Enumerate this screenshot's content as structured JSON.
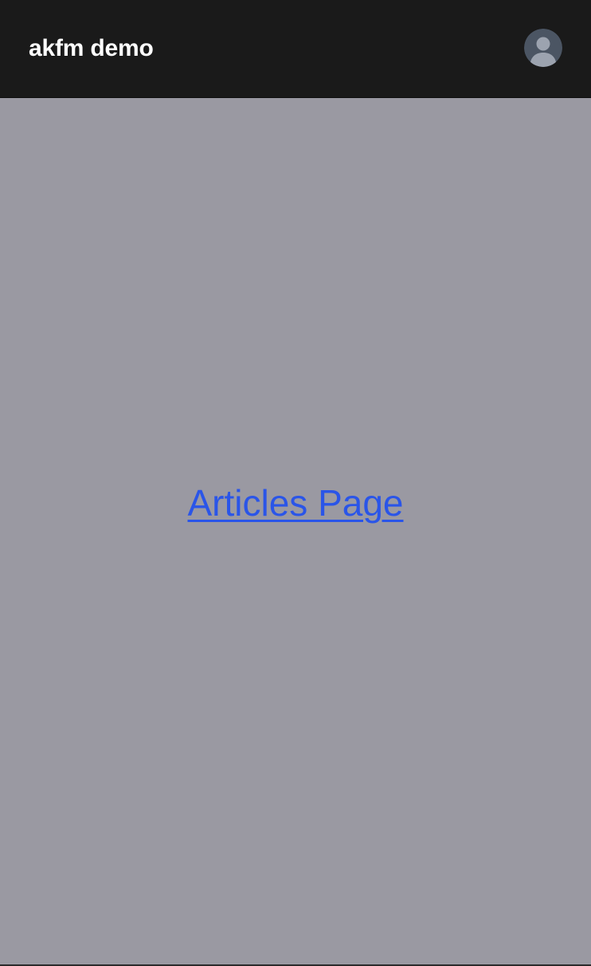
{
  "header": {
    "app_title": "akfm demo",
    "avatar_icon": "user-avatar-icon"
  },
  "main": {
    "link_label": "Articles Page"
  },
  "colors": {
    "header_background": "#1a1a1a",
    "page_background": "#9a99a2",
    "link": "#2a55e8",
    "avatar_background": "#4b5563",
    "avatar_figure": "#9ca3af"
  }
}
